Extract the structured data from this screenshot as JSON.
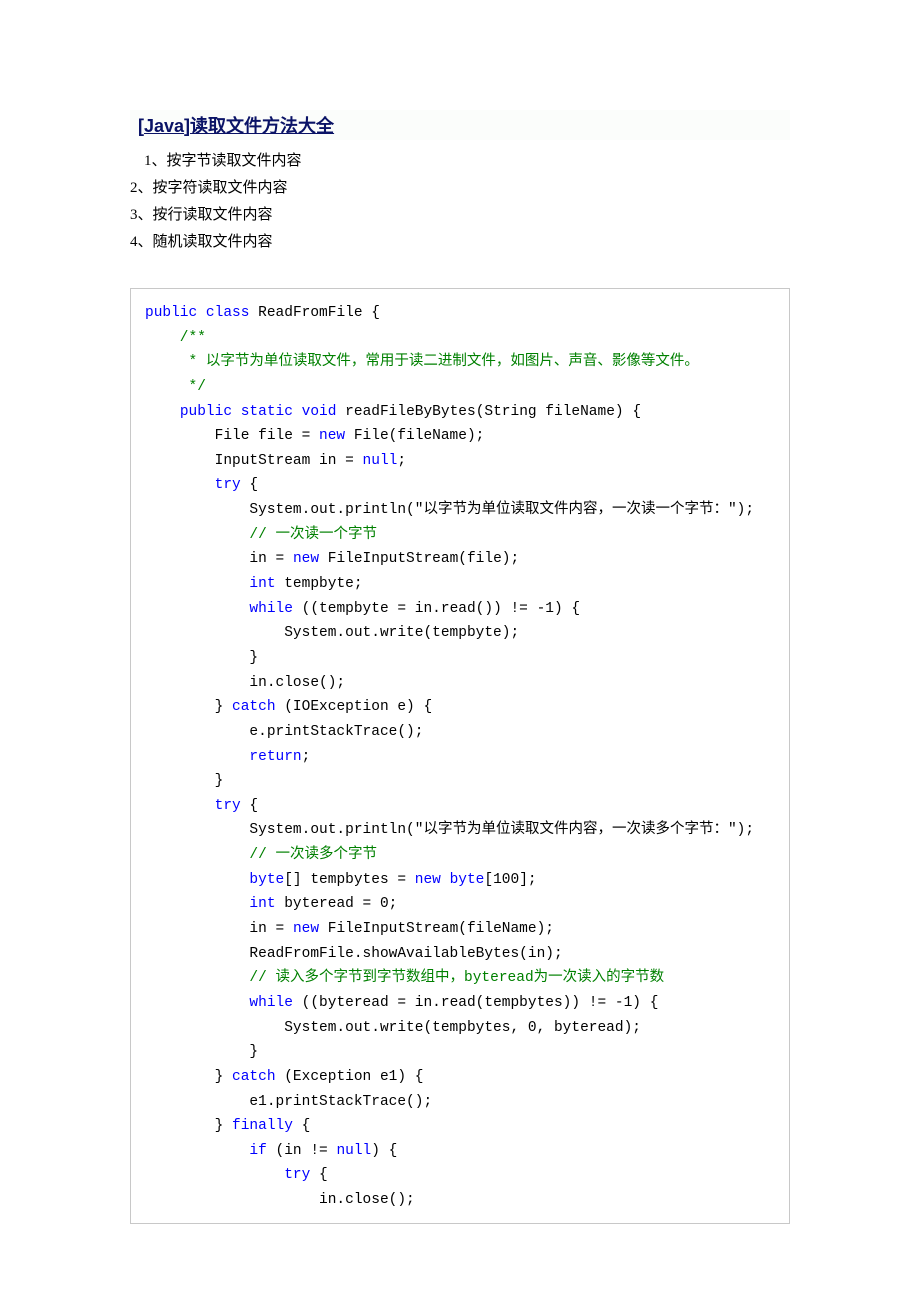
{
  "title": {
    "bracket_open": "[",
    "lang": "Java",
    "bracket_close": "]",
    "cn": "读取文件方法大全"
  },
  "list": {
    "i1": "1、按字节读取文件内容",
    "i2": "2、按字符读取文件内容",
    "i3": "3、按行读取文件内容",
    "i4": "4、随机读取文件内容"
  },
  "code": {
    "l01a": "public",
    "l01b": "class",
    "l01c": " ReadFromFile {",
    "l02": "    /**",
    "l03": "     * 以字节为单位读取文件，常用于读二进制文件，如图片、声音、影像等文件。",
    "l04": "     */",
    "l05a": "public",
    "l05b": "static",
    "l05c": "void",
    "l05d": " readFileByBytes(String fileName) {",
    "l06a": "        File file = ",
    "l06b": "new",
    "l06c": " File(fileName);",
    "l07a": "        InputStream in = ",
    "l07b": "null",
    "l07c": ";",
    "l08a": "try",
    "l08b": " {",
    "l09": "            System.out.println(\"以字节为单位读取文件内容，一次读一个字节：\");",
    "l10": "            // 一次读一个字节",
    "l11a": "            in = ",
    "l11b": "new",
    "l11c": " FileInputStream(file);",
    "l12a": "int",
    "l12b": " tempbyte;",
    "l13a": "while",
    "l13b": " ((tempbyte = in.read()) != -1) {",
    "l14": "                System.out.write(tempbyte);",
    "l15": "            }",
    "l16": "            in.close();",
    "l17a": "        } ",
    "l17b": "catch",
    "l17c": " (IOException e) {",
    "l18": "            e.printStackTrace();",
    "l19a": "return",
    "l19b": ";",
    "l20": "        }",
    "l21a": "try",
    "l21b": " {",
    "l22": "            System.out.println(\"以字节为单位读取文件内容，一次读多个字节：\");",
    "l23": "            // 一次读多个字节",
    "l24a": "byte",
    "l24b": "[] tempbytes = ",
    "l24c": "new",
    "l24d": "byte",
    "l24e": "[100];",
    "l25a": "int",
    "l25b": " byteread = 0;",
    "l26a": "            in = ",
    "l26b": "new",
    "l26c": " FileInputStream(fileName);",
    "l27": "            ReadFromFile.showAvailableBytes(in);",
    "l28a": "            // 读入多个字节到字节数组中，",
    "l28b": "byteread",
    "l28c": "为一次读入的字节数",
    "l29a": "while",
    "l29b": " ((byteread = in.read(tempbytes)) != -1) {",
    "l30": "                System.out.write(tempbytes, 0, byteread);",
    "l31": "            }",
    "l32a": "        } ",
    "l32b": "catch",
    "l32c": " (Exception e1) {",
    "l33": "            e1.printStackTrace();",
    "l34a": "        } ",
    "l34b": "finally",
    "l34c": " {",
    "l35a": "if",
    "l35b": " (in != ",
    "l35c": "null",
    "l35d": ") {",
    "l36a": "try",
    "l36b": " {",
    "l37": "                    in.close();"
  }
}
